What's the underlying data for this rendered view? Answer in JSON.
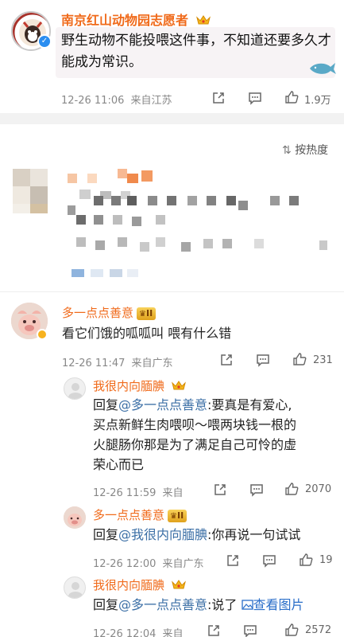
{
  "post": {
    "author": "南京红山动物园志愿者",
    "text": "野生动物不能投喂这件事，不知道还要多久才能成为常识。",
    "time": "12-26 11:06",
    "source": "来自江苏",
    "like_count": "1.9万"
  },
  "sort": {
    "label": "按热度"
  },
  "comments": [
    {
      "author": "多一点点善意",
      "level": "II",
      "text": "看它们饿的呱呱叫 喂有什么错",
      "time": "12-26 11:47",
      "source": "来自广东",
      "like_count": "231"
    }
  ],
  "replies": [
    {
      "author": "我很内向腼腆",
      "prefix": "回复",
      "mention": "@多一点点善意",
      "text_line1": ":要真是有爱心,",
      "text_line2": "买点新鲜生肉喂呗～喂两块钱一根的",
      "text_line3": "火腿肠你那是为了满足自己可怜的虚",
      "text_line4": "荣心而已",
      "time": "12-26 11:59",
      "source": "来自",
      "like_count": "2070"
    },
    {
      "author": "多一点点善意",
      "level": "II",
      "prefix": "回复",
      "mention": "@我很内向腼腆",
      "text": ":你再说一句试试",
      "time": "12-26 12:00",
      "source": "来自广东",
      "like_count": "19"
    },
    {
      "author": "我很内向腼腆",
      "prefix": "回复",
      "mention": "@多一点点善意",
      "text": ":说了",
      "view_image": "查看图片",
      "time": "12-26 12:04",
      "source": "来自",
      "like_count": "2572"
    }
  ],
  "colors": {
    "name": "#f06a1a",
    "mention": "#3a6ea5",
    "link": "#2a6ec9",
    "divider": "#f2f2f2"
  },
  "icons": [
    "verified-icon",
    "crown-icon",
    "whale-icon",
    "share-icon",
    "comment-icon",
    "like-icon",
    "sort-icon",
    "image-icon"
  ]
}
